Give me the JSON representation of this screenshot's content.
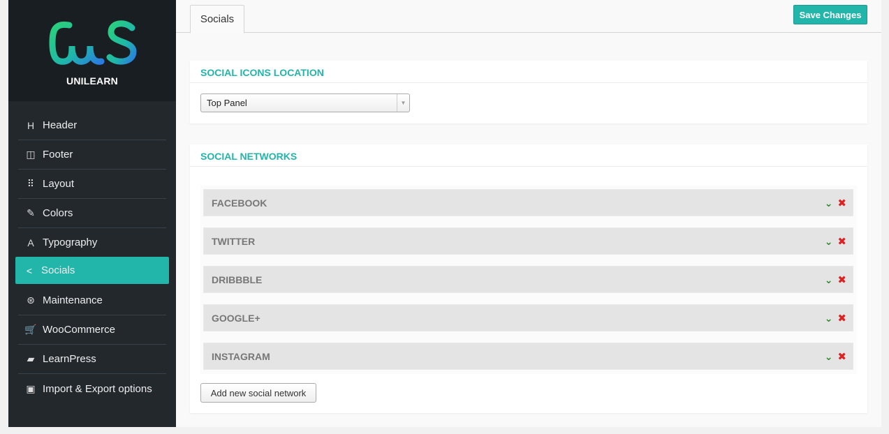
{
  "brand": {
    "name": "UNILEARN",
    "accent": "#22b5aa"
  },
  "sidebar": {
    "items": [
      {
        "label": "Header",
        "icon": "heading-icon",
        "glyph": "H"
      },
      {
        "label": "Footer",
        "icon": "footer-icon",
        "glyph": "◫"
      },
      {
        "label": "Layout",
        "icon": "grid-icon",
        "glyph": "⠿"
      },
      {
        "label": "Colors",
        "icon": "brush-icon",
        "glyph": "✎"
      },
      {
        "label": "Typography",
        "icon": "font-icon",
        "glyph": "A"
      },
      {
        "label": "Socials",
        "icon": "share-icon",
        "glyph": "<",
        "active": true
      },
      {
        "label": "Maintenance",
        "icon": "lifebuoy-icon",
        "glyph": "⊛"
      },
      {
        "label": "WooCommerce",
        "icon": "cart-icon",
        "glyph": "🛒"
      },
      {
        "label": "LearnPress",
        "icon": "book-icon",
        "glyph": "▰"
      },
      {
        "label": "Import & Export options",
        "icon": "calendar-icon",
        "glyph": "▣"
      }
    ]
  },
  "header": {
    "tab_label": "Socials",
    "save_label": "Save Changes"
  },
  "icons_location": {
    "title": "SOCIAL ICONS LOCATION",
    "selected": "Top Panel"
  },
  "social_networks": {
    "title": "SOCIAL NETWORKS",
    "items": [
      {
        "name": "FACEBOOK"
      },
      {
        "name": "TWITTER"
      },
      {
        "name": "DRIBBBLE"
      },
      {
        "name": "GOOGLE+"
      },
      {
        "name": "INSTAGRAM"
      }
    ],
    "add_label": "Add new social network"
  }
}
